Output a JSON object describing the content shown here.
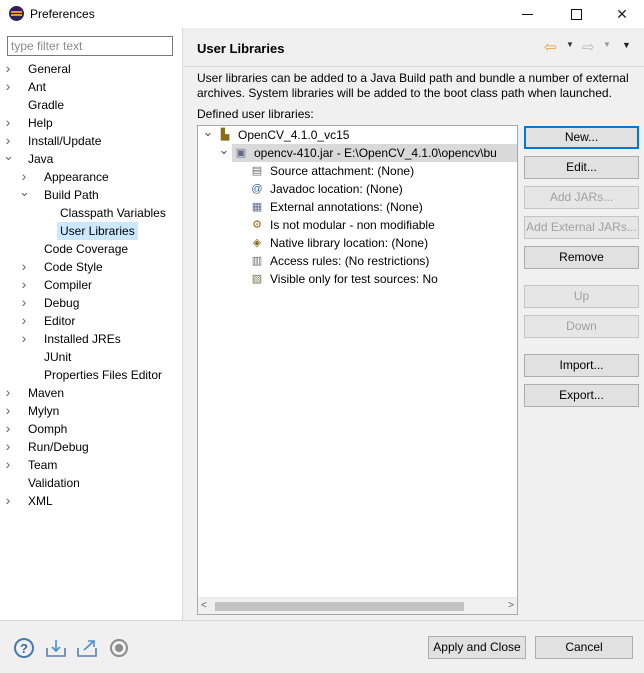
{
  "window": {
    "title": "Preferences",
    "minimize": "minimize",
    "maximize": "maximize",
    "close": "✕"
  },
  "filter": {
    "placeholder": "type filter text",
    "value": ""
  },
  "tree": [
    {
      "label": "General",
      "depth": 0,
      "twisty": "collapsed"
    },
    {
      "label": "Ant",
      "depth": 0,
      "twisty": "collapsed"
    },
    {
      "label": "Gradle",
      "depth": 0,
      "twisty": "none"
    },
    {
      "label": "Help",
      "depth": 0,
      "twisty": "collapsed"
    },
    {
      "label": "Install/Update",
      "depth": 0,
      "twisty": "collapsed"
    },
    {
      "label": "Java",
      "depth": 0,
      "twisty": "expanded"
    },
    {
      "label": "Appearance",
      "depth": 1,
      "twisty": "collapsed"
    },
    {
      "label": "Build Path",
      "depth": 1,
      "twisty": "expanded"
    },
    {
      "label": "Classpath Variables",
      "depth": 2,
      "twisty": "none"
    },
    {
      "label": "User Libraries",
      "depth": 2,
      "twisty": "none",
      "selected": true
    },
    {
      "label": "Code Coverage",
      "depth": 1,
      "twisty": "none"
    },
    {
      "label": "Code Style",
      "depth": 1,
      "twisty": "collapsed"
    },
    {
      "label": "Compiler",
      "depth": 1,
      "twisty": "collapsed"
    },
    {
      "label": "Debug",
      "depth": 1,
      "twisty": "collapsed"
    },
    {
      "label": "Editor",
      "depth": 1,
      "twisty": "collapsed"
    },
    {
      "label": "Installed JREs",
      "depth": 1,
      "twisty": "collapsed"
    },
    {
      "label": "JUnit",
      "depth": 1,
      "twisty": "none"
    },
    {
      "label": "Properties Files Editor",
      "depth": 1,
      "twisty": "none"
    },
    {
      "label": "Maven",
      "depth": 0,
      "twisty": "collapsed"
    },
    {
      "label": "Mylyn",
      "depth": 0,
      "twisty": "collapsed"
    },
    {
      "label": "Oomph",
      "depth": 0,
      "twisty": "collapsed"
    },
    {
      "label": "Run/Debug",
      "depth": 0,
      "twisty": "collapsed"
    },
    {
      "label": "Team",
      "depth": 0,
      "twisty": "collapsed"
    },
    {
      "label": "Validation",
      "depth": 0,
      "twisty": "none"
    },
    {
      "label": "XML",
      "depth": 0,
      "twisty": "collapsed"
    }
  ],
  "page": {
    "title": "User Libraries",
    "description": "User libraries can be added to a Java Build path and bundle a number of external archives. System libraries will be added to the boot class path when launched.",
    "defined_label": "Defined user libraries:"
  },
  "libraries": [
    {
      "label": "OpenCV_4.1.0_vc15",
      "depth": 0,
      "twisty": "expanded",
      "icon": "library-icon"
    },
    {
      "label": "opencv-410.jar - E:\\OpenCV_4.1.0\\opencv\\bu",
      "depth": 1,
      "twisty": "expanded",
      "icon": "jar-icon",
      "selected": true
    },
    {
      "label": "Source attachment: (None)",
      "depth": 2,
      "twisty": "none",
      "icon": "source-attachment-icon"
    },
    {
      "label": "Javadoc location: (None)",
      "depth": 2,
      "twisty": "none",
      "icon": "javadoc-icon"
    },
    {
      "label": "External annotations: (None)",
      "depth": 2,
      "twisty": "none",
      "icon": "annotations-icon"
    },
    {
      "label": "Is not modular - non modifiable",
      "depth": 2,
      "twisty": "none",
      "icon": "module-icon"
    },
    {
      "label": "Native library location: (None)",
      "depth": 2,
      "twisty": "none",
      "icon": "native-library-icon"
    },
    {
      "label": "Access rules: (No restrictions)",
      "depth": 2,
      "twisty": "none",
      "icon": "access-rules-icon"
    },
    {
      "label": "Visible only for test sources: No",
      "depth": 2,
      "twisty": "none",
      "icon": "test-sources-icon"
    }
  ],
  "buttons": {
    "new": "New...",
    "edit": "Edit...",
    "add_jars": "Add JARs...",
    "add_external_jars": "Add External JARs...",
    "remove": "Remove",
    "up": "Up",
    "down": "Down",
    "import": "Import...",
    "export": "Export..."
  },
  "footer": {
    "apply_close": "Apply and Close",
    "cancel": "Cancel"
  }
}
